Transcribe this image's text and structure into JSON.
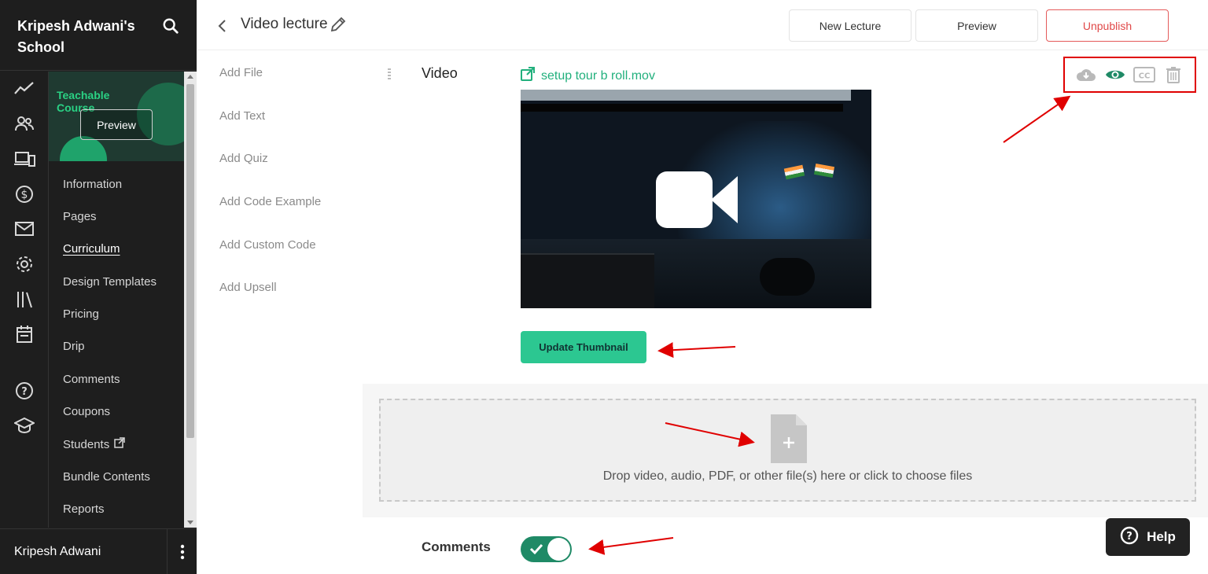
{
  "colors": {
    "sidebar_bg": "#1e1e1e",
    "accent_green": "#2cc791",
    "link_green": "#22b07d",
    "toggle_green": "#1f8a66",
    "unpublish_red": "#e04848",
    "annotation_red": "#e00000"
  },
  "sidebar": {
    "school_name": "Kripesh Adwani's School",
    "search_icon": "search-icon",
    "rail_icons": [
      "trend-chart-icon",
      "users-icon",
      "devices-icon",
      "dollar-icon",
      "mail-icon",
      "gear-icon",
      "library-icon",
      "calendar-icon",
      "help-circle-icon",
      "graduation-cap-icon"
    ],
    "course_thumbnail": {
      "title": "Teachable Course",
      "preview_label": "Preview"
    },
    "nav_items": [
      {
        "label": "Information"
      },
      {
        "label": "Pages"
      },
      {
        "label": "Curriculum",
        "active": true
      },
      {
        "label": "Design Templates"
      },
      {
        "label": "Pricing"
      },
      {
        "label": "Drip"
      },
      {
        "label": "Comments"
      },
      {
        "label": "Coupons"
      },
      {
        "label": "Students",
        "external": true
      },
      {
        "label": "Bundle Contents"
      },
      {
        "label": "Reports"
      }
    ],
    "user_name": "Kripesh Adwani"
  },
  "header": {
    "title": "Video lecture",
    "buttons": {
      "new_lecture": "New Lecture",
      "preview": "Preview",
      "unpublish": "Unpublish"
    }
  },
  "add_blocks": [
    {
      "label": "Add File"
    },
    {
      "label": "Add Text"
    },
    {
      "label": "Add Quiz"
    },
    {
      "label": "Add Code Example"
    },
    {
      "label": "Add Custom Code"
    },
    {
      "label": "Add Upsell"
    }
  ],
  "video_block": {
    "label": "Video",
    "file_name": "setup tour b roll.mov",
    "actions": [
      "cloud-download-icon",
      "eye-icon",
      "closed-captions-icon",
      "trash-icon"
    ],
    "update_thumbnail_label": "Update Thumbnail"
  },
  "dropzone": {
    "text": "Drop video, audio, PDF, or other file(s) here or click to choose files"
  },
  "comments": {
    "label": "Comments",
    "enabled": true
  },
  "help": {
    "label": "Help"
  }
}
